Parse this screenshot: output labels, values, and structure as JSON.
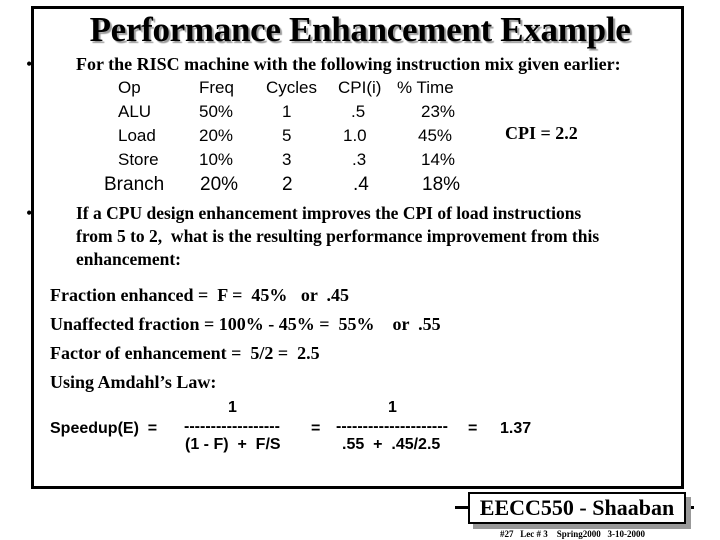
{
  "slide": {
    "title": "Performance Enhancement Example",
    "bullet_glyph": "•",
    "intro": "For the RISC machine with the following instruction mix given earlier:",
    "table": {
      "headers": [
        "Op",
        "Freq",
        "Cycles",
        "CPI(i)",
        "% Time"
      ],
      "rows": [
        [
          "ALU",
          "50%",
          "1",
          ".5",
          "23%"
        ],
        [
          "Load",
          "20%",
          "5",
          "1.0",
          "45%"
        ],
        [
          "Store",
          "10%",
          "3",
          ".3",
          "14%"
        ],
        [
          "Branch",
          "20%",
          "2",
          ".4",
          "18%"
        ]
      ]
    },
    "cpi_total": "CPI = 2.2",
    "question": [
      "If a CPU design enhancement improves the CPI of load instructions",
      "from 5 to 2,  what is the resulting performance improvement from this",
      "enhancement:"
    ],
    "calc": [
      "Fraction enhanced =  F =  45%   or  .45",
      "Unaffected fraction = 100% - 45% =  55%    or  .55",
      "Factor of enhancement =  5/2 =  2.5",
      "Using Amdahl’s Law:"
    ],
    "equation": {
      "lhs": "Speedup(E)  =",
      "num1": "1",
      "bar1": "------------------",
      "den1": "(1 - F)  +  F/S",
      "eq2": "=",
      "num2": "1",
      "bar2": "---------------------",
      "den2": ".55  +  .45/2.5",
      "eq3": "=",
      "result": "1.37"
    },
    "footer": {
      "label": "EECC550 - Shaaban",
      "note": "#27   Lec # 3    Spring2000   3-10-2000"
    }
  }
}
